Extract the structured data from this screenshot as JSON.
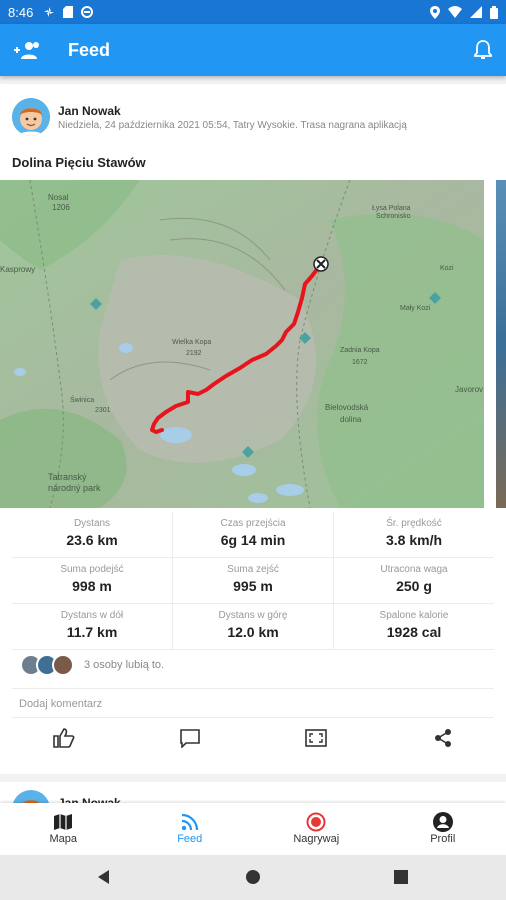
{
  "status_bar": {
    "time": "8:46"
  },
  "app_bar": {
    "title": "Feed",
    "left_icon": "add-friend-icon",
    "right_icon": "bell-icon"
  },
  "post": {
    "author": "Jan Nowak",
    "subtitle": "Niedziela, 24 października 2021 05:54, Tatry Wysokie. Trasa nagrana aplikacją",
    "title": "Dolina Pięciu Stawów",
    "map": {
      "labels": [
        "Nosal 1206",
        "Łysa Polana Schronisko",
        "Kozi Wierch",
        "Mały Kozi",
        "Wielka Kopa Krzyska 2192",
        "Zadnia Kopa 1672",
        "Świnica / Świnica 2301",
        "Bielovodská dolina",
        "Tatranský národný park",
        "Javorov dolina",
        "Kasprowy Wierch 1987"
      ]
    },
    "stats": [
      [
        {
          "label": "Dystans",
          "value": "23.6 km"
        },
        {
          "label": "Czas przejścia",
          "value": "6g 14 min"
        },
        {
          "label": "Śr. prędkość",
          "value": "3.8 km/h"
        }
      ],
      [
        {
          "label": "Suma podejść",
          "value": "998 m"
        },
        {
          "label": "Suma zejść",
          "value": "995 m"
        },
        {
          "label": "Utracona waga",
          "value": "250 g"
        }
      ],
      [
        {
          "label": "Dystans w dół",
          "value": "11.7 km"
        },
        {
          "label": "Dystans w górę",
          "value": "12.0 km"
        },
        {
          "label": "Spalone kalorie",
          "value": "1928 cal"
        }
      ]
    ],
    "likes_text": "3 osoby lubią to.",
    "comment_placeholder": "Dodaj komentarz",
    "actions": [
      "thumb-up-icon",
      "comment-icon",
      "fullscreen-icon",
      "share-icon"
    ]
  },
  "next_post": {
    "author": "Jan Nowak"
  },
  "bottom_nav": [
    {
      "label": "Mapa",
      "icon": "map-icon",
      "active": false
    },
    {
      "label": "Feed",
      "icon": "rss-icon",
      "active": true
    },
    {
      "label": "Nagrywaj",
      "icon": "record-icon",
      "active": false
    },
    {
      "label": "Profil",
      "icon": "profile-icon",
      "active": false
    }
  ],
  "colors": {
    "primary": "#2196f3",
    "statusbar": "#1976d2",
    "route": "#e8141c",
    "record": "#e53935"
  }
}
